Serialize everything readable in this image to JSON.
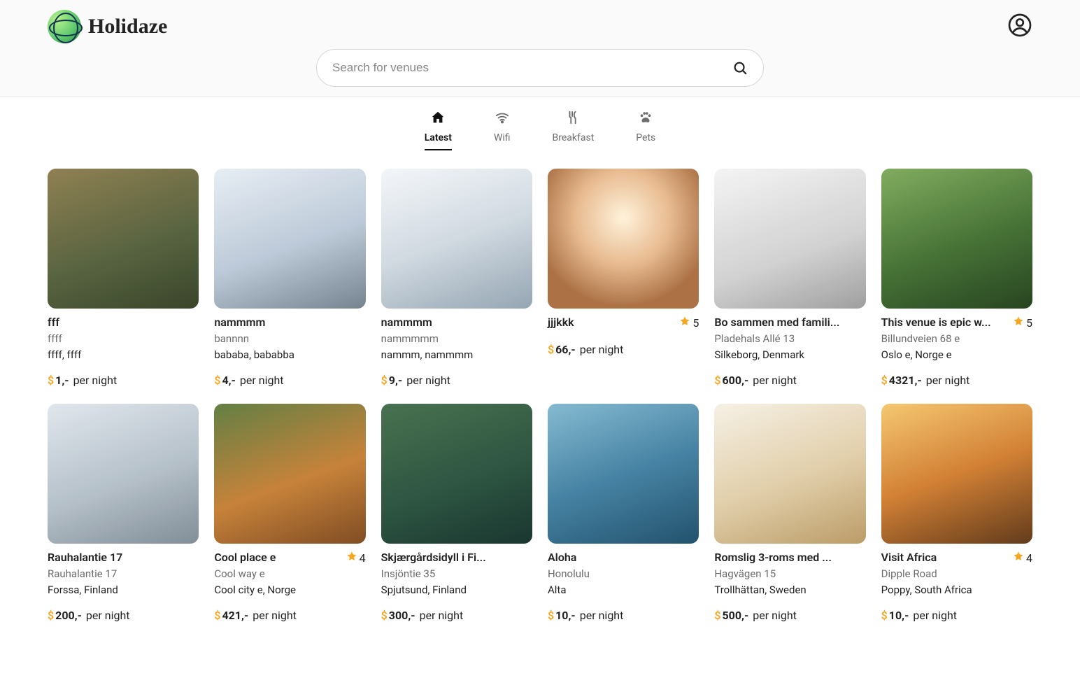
{
  "brand": "Holidaze",
  "search": {
    "placeholder": "Search for venues"
  },
  "filters": [
    {
      "key": "latest",
      "label": "Latest",
      "icon": "home-icon",
      "active": true
    },
    {
      "key": "wifi",
      "label": "Wifi",
      "icon": "wifi-icon",
      "active": false
    },
    {
      "key": "breakfast",
      "label": "Breakfast",
      "icon": "utensils-icon",
      "active": false
    },
    {
      "key": "pets",
      "label": "Pets",
      "icon": "paw-icon",
      "active": false
    }
  ],
  "currency_symbol": "$",
  "per_night_label": "per night",
  "venues": [
    {
      "title": "fff",
      "street": "ffff",
      "city": "ffff, ffff",
      "price": "1,-",
      "rating": null
    },
    {
      "title": "nammmm",
      "street": "bannnn",
      "city": "bababa, bababba",
      "price": "4,-",
      "rating": null
    },
    {
      "title": "nammmm",
      "street": "nammmmm",
      "city": "nammm, nammmm",
      "price": "9,-",
      "rating": null
    },
    {
      "title": "jjjkkk",
      "street": null,
      "city": null,
      "price": "66,-",
      "rating": 5
    },
    {
      "title": "Bo sammen med famili...",
      "street": "Pladehals Allé 13",
      "city": "Silkeborg, Denmark",
      "price": "600,-",
      "rating": null
    },
    {
      "title": "This venue is epic w...",
      "street": "Billundveien 68 e",
      "city": "Oslo e, Norge e",
      "price": "4321,-",
      "rating": 5
    },
    {
      "title": "Rauhalantie 17",
      "street": "Rauhalantie 17",
      "city": "Forssa, Finland",
      "price": "200,-",
      "rating": null
    },
    {
      "title": "Cool place e",
      "street": "Cool way e",
      "city": "Cool city e, Norge",
      "price": "421,-",
      "rating": 4
    },
    {
      "title": "Skjærgårdsidyll i Fi...",
      "street": "Insjöntie 35",
      "city": "Spjutsund, Finland",
      "price": "300,-",
      "rating": null
    },
    {
      "title": "Aloha",
      "street": "Honolulu",
      "city": "Alta",
      "price": "10,-",
      "rating": null
    },
    {
      "title": "Romslig 3-roms med ...",
      "street": "Hagvägen 15",
      "city": "Trollhättan, Sweden",
      "price": "500,-",
      "rating": null
    },
    {
      "title": "Visit Africa",
      "street": "Dipple Road",
      "city": "Poppy, South Africa",
      "price": "10,-",
      "rating": 4
    }
  ]
}
